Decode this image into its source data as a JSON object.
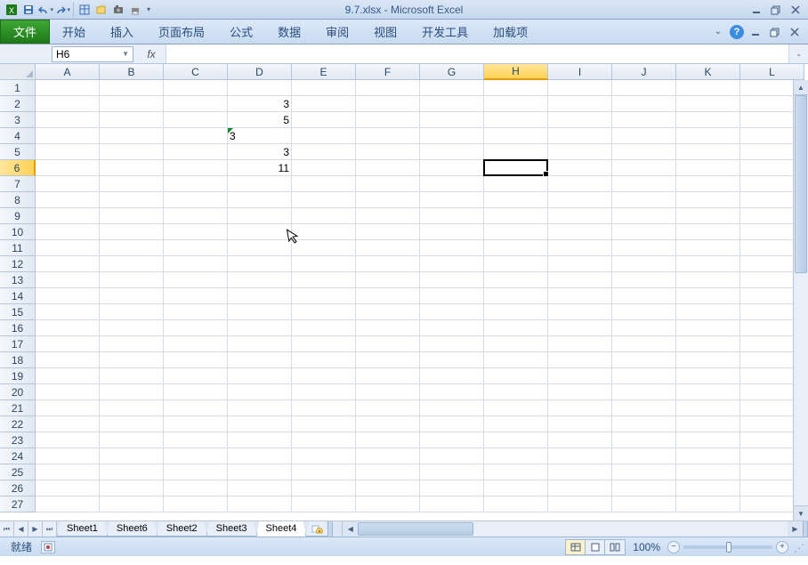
{
  "title": {
    "filename": "9.7.xlsx",
    "app": "Microsoft Excel"
  },
  "qat": {
    "icons": [
      "excel-icon",
      "save-icon",
      "undo-icon",
      "redo-icon",
      "print-icon",
      "open-icon",
      "camera-icon",
      "quick-print-icon"
    ]
  },
  "ribbon": {
    "file": "文件",
    "tabs": [
      "开始",
      "插入",
      "页面布局",
      "公式",
      "数据",
      "审阅",
      "视图",
      "开发工具",
      "加载项"
    ]
  },
  "namebox": {
    "value": "H6"
  },
  "formula_bar": {
    "fx": "fx",
    "value": ""
  },
  "columns": [
    "A",
    "B",
    "C",
    "D",
    "E",
    "F",
    "G",
    "H",
    "I",
    "J",
    "K",
    "L"
  ],
  "rows_count": 27,
  "selected": {
    "col": "H",
    "row": 6
  },
  "cells": {
    "D2": "3",
    "D3": "5",
    "D4": "3",
    "D4_textleft": true,
    "D4_error": true,
    "D5": "3",
    "D6": "11"
  },
  "sheets": {
    "nav": [
      "⏮",
      "◀",
      "▶",
      "⏭"
    ],
    "tabs": [
      {
        "name": "Sheet1",
        "active": false
      },
      {
        "name": "Sheet6",
        "active": false
      },
      {
        "name": "Sheet2",
        "active": false
      },
      {
        "name": "Sheet3",
        "active": false
      },
      {
        "name": "Sheet4",
        "active": true
      }
    ]
  },
  "status": {
    "ready": "就绪",
    "zoom": "100%"
  }
}
